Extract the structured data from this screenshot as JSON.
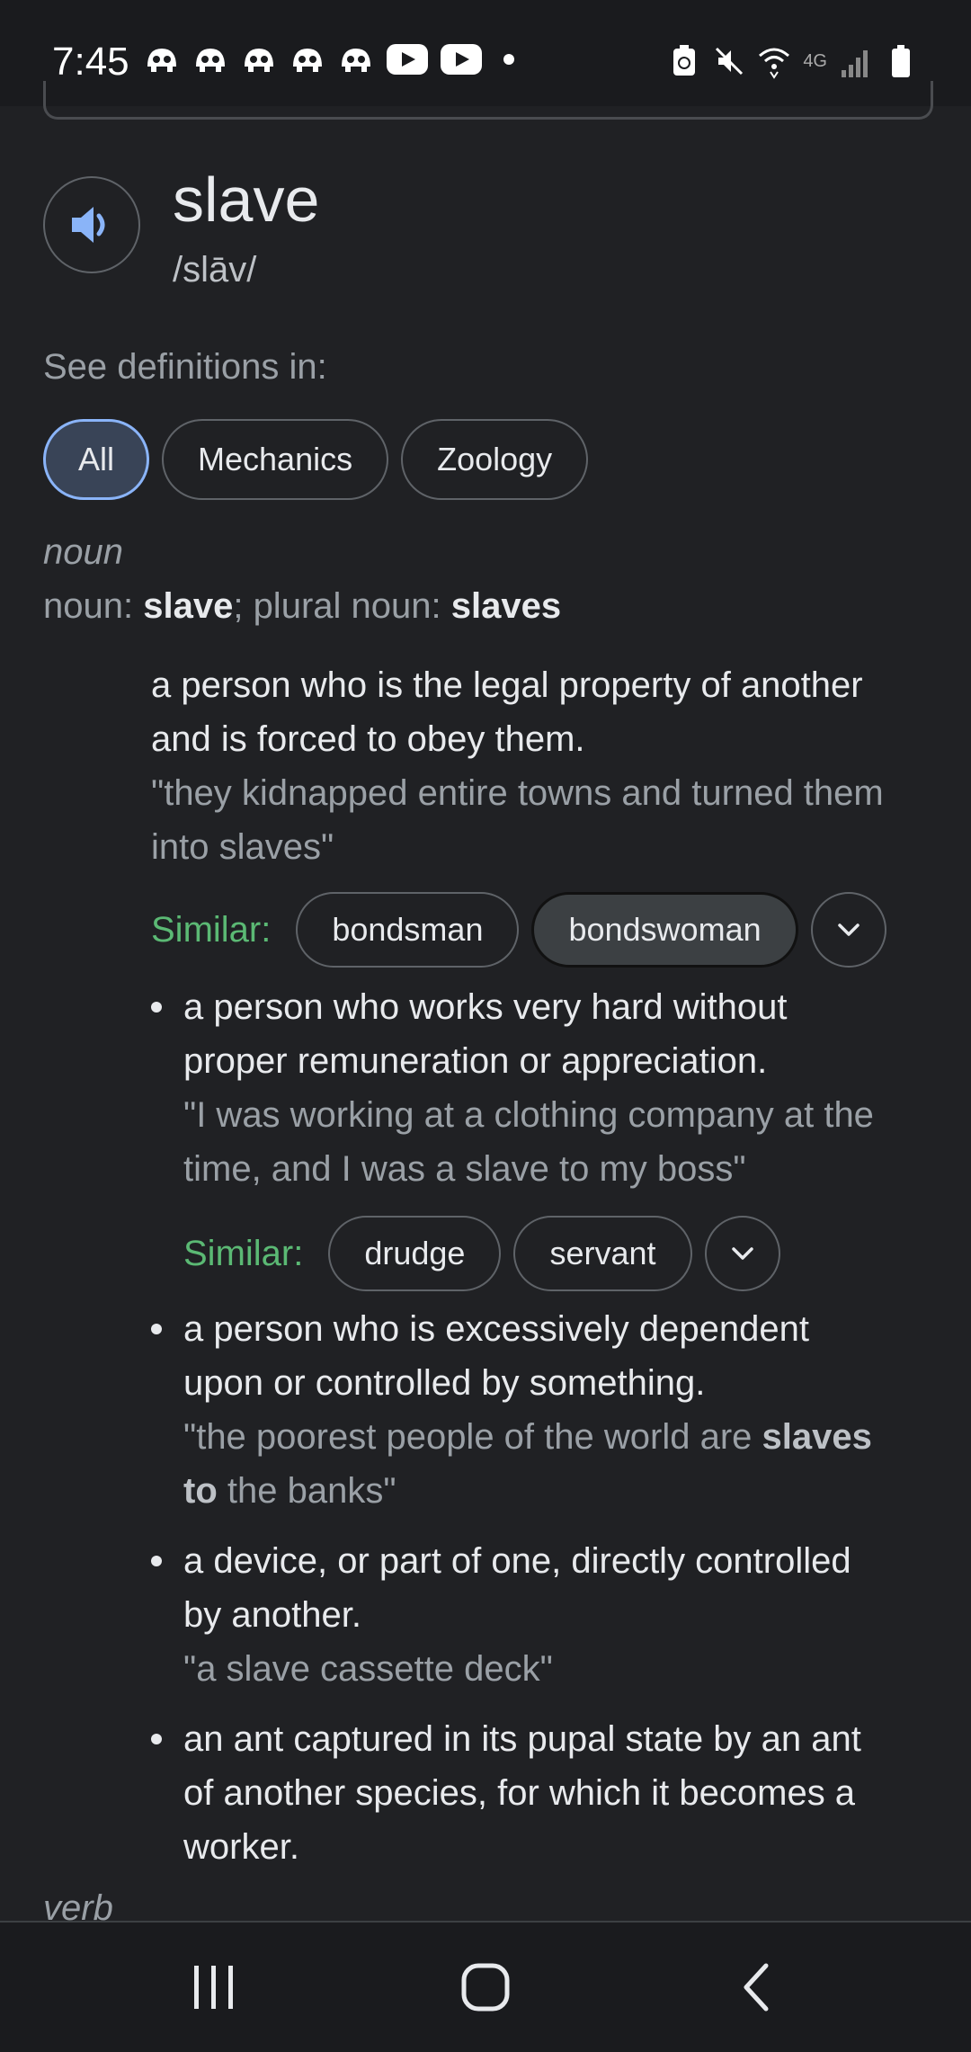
{
  "status_bar": {
    "time": "7:45",
    "network_label": "4G"
  },
  "entry": {
    "headword": "slave",
    "pronunciation": "/slāv/",
    "see_definitions_label": "See definitions in:",
    "domain_chips": [
      "All",
      "Mechanics",
      "Zoology"
    ],
    "noun_label": "noun",
    "verb_label": "verb",
    "forms": {
      "noun_prefix": "noun",
      "singular": "slave",
      "plural_prefix": "plural noun",
      "plural": "slaves"
    }
  },
  "definitions": [
    {
      "text_line1": "a person who is the legal property of another",
      "text_line2": "and is forced to obey them.",
      "example_line1": "\"they kidnapped entire towns and turned them",
      "example_line2": "into slaves\"",
      "similar_label": "Similar:",
      "similar": [
        "bondsman",
        "bondswoman"
      ]
    },
    {
      "text_line1": "a person who works very hard without",
      "text_line2": "proper remuneration or appreciation.",
      "example_line1": "\"I was working at a clothing company at the",
      "example_line2": "time, and I was a slave to my boss\"",
      "similar_label": "Similar:",
      "similar": [
        "drudge",
        "servant"
      ]
    },
    {
      "text_line1": "a person who is excessively dependent",
      "text_line2": "upon or controlled by something.",
      "example_pre": "\"the poorest people of the world are ",
      "example_bold1": "slaves",
      "example_bold2": "to",
      "example_post": " the banks\""
    },
    {
      "text_line1": "a device, or part of one, directly controlled",
      "text_line2": "by another.",
      "example_line1": "\"a slave cassette deck\""
    },
    {
      "text_line1": "an ant captured in its pupal state by an ant",
      "text_line2": "of another species, for which it becomes a",
      "text_line3": "worker."
    }
  ],
  "icons": {
    "speaker": "speaker-icon",
    "expand": "chevron-down-icon",
    "nav_recent": "recent-apps-icon",
    "nav_home": "home-icon",
    "nav_back": "back-icon"
  },
  "colors": {
    "background": "#202124",
    "accent_blue": "#8ab4f8",
    "similar_green": "#5bb974"
  }
}
